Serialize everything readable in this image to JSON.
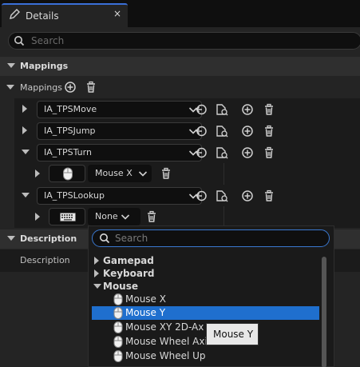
{
  "tab": {
    "title": "Details",
    "close": "×"
  },
  "search": {
    "placeholder": "Search"
  },
  "sections": {
    "mappings": "Mappings",
    "description": "Description"
  },
  "mappings": {
    "label": "Mappings",
    "items": [
      {
        "action": "IA_TPSMove"
      },
      {
        "action": "IA_TPSJump"
      },
      {
        "action": "IA_TPSTurn",
        "key": "Mouse X"
      },
      {
        "action": "IA_TPSLookup",
        "key": "None"
      }
    ]
  },
  "description_row": {
    "label": "Description"
  },
  "dropdown": {
    "search_placeholder": "Search",
    "items": [
      {
        "label": "Gamepad",
        "type": "category"
      },
      {
        "label": "Keyboard",
        "type": "category"
      },
      {
        "label": "Mouse",
        "type": "category"
      },
      {
        "label": "Mouse X",
        "type": "key"
      },
      {
        "label": "Mouse Y",
        "type": "key",
        "selected": true
      },
      {
        "label": "Mouse XY 2D-Ax",
        "type": "key"
      },
      {
        "label": "Mouse Wheel Axi",
        "type": "key"
      },
      {
        "label": "Mouse Wheel Up",
        "type": "key"
      }
    ]
  },
  "tooltip": {
    "text": "Mouse Y"
  },
  "colors": {
    "accent": "#1f6fce",
    "panel": "#242424",
    "field": "#0f0f0f"
  }
}
